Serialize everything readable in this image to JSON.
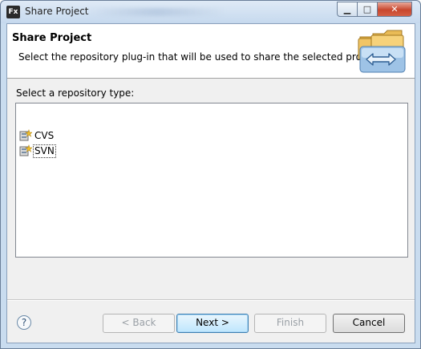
{
  "window": {
    "app_icon": "Fx",
    "title": "Share Project"
  },
  "titlebar_buttons": {
    "minimize": "▁",
    "maximize": "□",
    "close": "✕"
  },
  "header": {
    "title": "Share Project",
    "description": "Select the repository plug-in that will be used to share the selected project.",
    "art_icon": "folder-share-icon"
  },
  "section_label": "Select a repository type:",
  "repository_types": [
    {
      "label": "CVS",
      "icon": "repository-plugin-icon",
      "selected": false
    },
    {
      "label": "SVN",
      "icon": "repository-plugin-icon",
      "selected": true
    }
  ],
  "footer": {
    "help_icon": "?",
    "back": "< Back",
    "next": "Next >",
    "finish": "Finish",
    "cancel": "Cancel"
  },
  "colors": {
    "accent": "#3c7fb1",
    "titlebar": "#c6d9ee",
    "close": "#c8472e"
  }
}
